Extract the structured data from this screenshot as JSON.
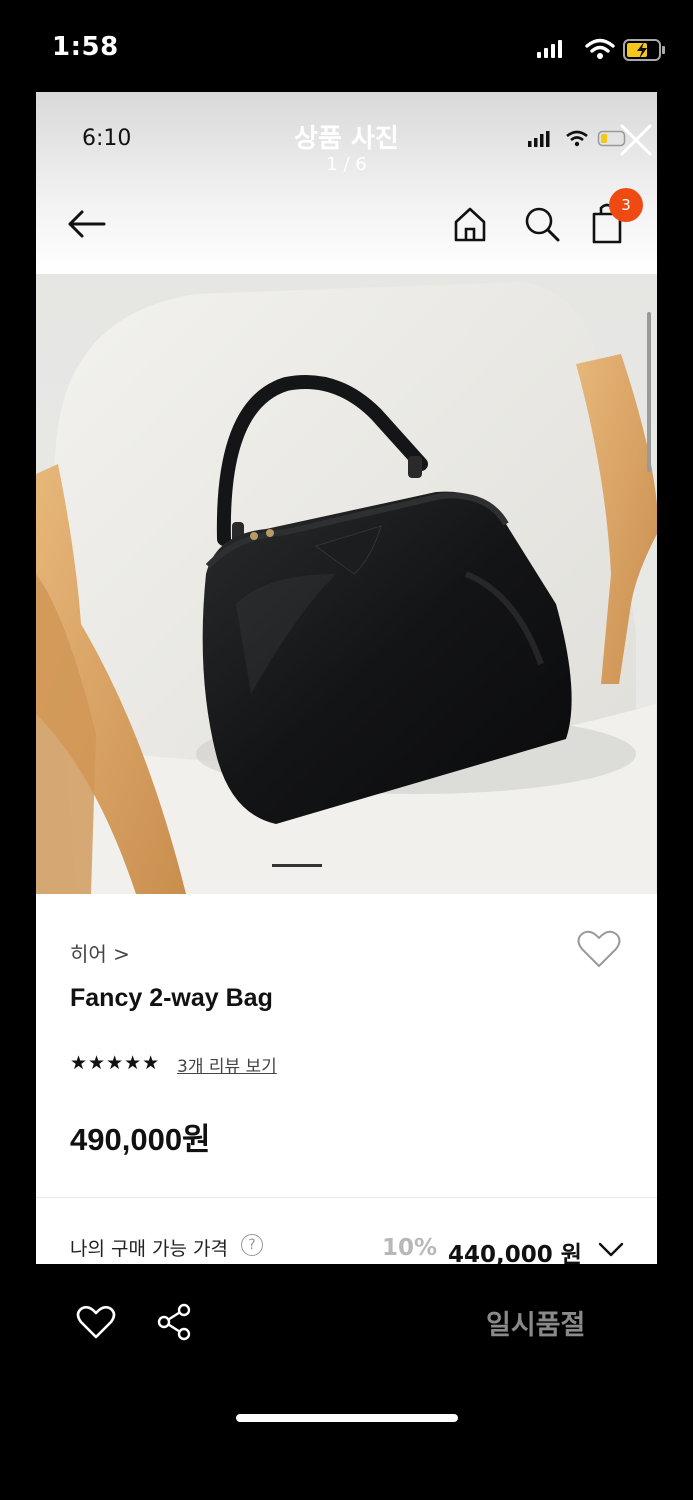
{
  "status_bar": {
    "time": "1:58"
  },
  "inner_status_bar": {
    "time": "6:10"
  },
  "viewer": {
    "title": "상품 사진",
    "counter": "1 / 6"
  },
  "header": {
    "cart_count": "3"
  },
  "product": {
    "brand": "히어 >",
    "name": "Fancy 2-way Bag",
    "rating_stars": "★★★★★",
    "review_link": "3개 리뷰 보기",
    "price": "490,000원",
    "image_index": 1,
    "image_total": 6
  },
  "my_price": {
    "label": "나의 구매 가능 가격",
    "help": "?",
    "discount": "10%",
    "price": "440,000 원"
  },
  "bottom_bar": {
    "sold_out": "일시품절"
  },
  "colors": {
    "accent_badge": "#f04a13",
    "battery_charging": "#f5c61c"
  },
  "icons": [
    "signal-icon",
    "wifi-icon",
    "battery-icon",
    "close-icon",
    "back-arrow-icon",
    "home-icon",
    "search-icon",
    "shopping-bag-icon",
    "heart-icon",
    "share-icon",
    "chevron-down-icon",
    "help-icon"
  ]
}
